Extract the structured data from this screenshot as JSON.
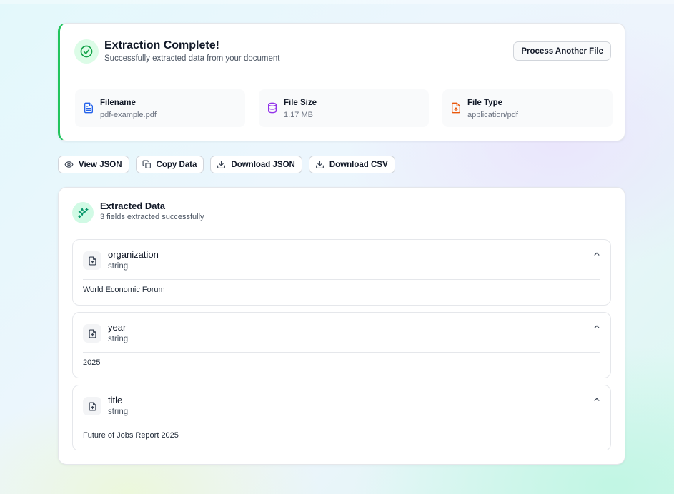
{
  "summary": {
    "title": "Extraction Complete!",
    "subtitle": "Successfully extracted data from your document",
    "process_button": "Process Another File",
    "accent_color": "#22c55e",
    "info": [
      {
        "label": "Filename",
        "value": "pdf-example.pdf",
        "icon": "file-text-icon",
        "color": "#2563eb"
      },
      {
        "label": "File Size",
        "value": "1.17 MB",
        "icon": "database-icon",
        "color": "#9333ea"
      },
      {
        "label": "File Type",
        "value": "application/pdf",
        "icon": "file-type-icon",
        "color": "#ea580c"
      }
    ]
  },
  "actions": [
    {
      "label": "View JSON",
      "icon": "eye-icon"
    },
    {
      "label": "Copy Data",
      "icon": "copy-icon"
    },
    {
      "label": "Download JSON",
      "icon": "download-icon"
    },
    {
      "label": "Download CSV",
      "icon": "download-icon"
    }
  ],
  "extracted": {
    "title": "Extracted Data",
    "subtitle": "3 fields extracted successfully",
    "icon": "sparkles-icon",
    "fields": [
      {
        "name": "organization",
        "type": "string",
        "value": "World Economic Forum",
        "expanded": true
      },
      {
        "name": "year",
        "type": "string",
        "value": "2025",
        "expanded": true
      },
      {
        "name": "title",
        "type": "string",
        "value": "Future of Jobs Report 2025",
        "expanded": true
      }
    ]
  }
}
